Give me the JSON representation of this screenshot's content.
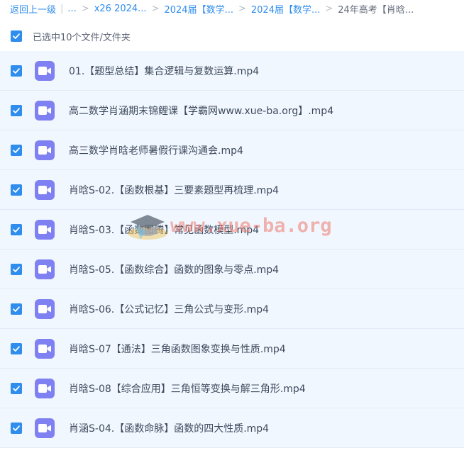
{
  "breadcrumb": {
    "back": "返回上一级",
    "ellipsis": "...",
    "items": [
      "x26 2024...",
      "2024届【数学...",
      "2024届【数学..."
    ],
    "current": "24年高考【肖晗..."
  },
  "selection": {
    "label": "已选中10个文件/文件夹"
  },
  "files": [
    {
      "name": "01.【题型总结】集合逻辑与复数运算.mp4"
    },
    {
      "name": "高二数学肖涵期末锦鲤课【学霸网www.xue-ba.org】.mp4"
    },
    {
      "name": "高三数学肖晗老师暑假行课沟通会.mp4"
    },
    {
      "name": "肖晗S-02.【函数根基】三要素题型再梳理.mp4"
    },
    {
      "name": "肖晗S-03.【函数图腾】常见函数模型.mp4"
    },
    {
      "name": "肖晗S-05.【函数综合】函数的图象与零点.mp4"
    },
    {
      "name": "肖晗S-06.【公式记忆】三角公式与变形.mp4"
    },
    {
      "name": "肖晗S-07【通法】三角函数图象变换与性质.mp4"
    },
    {
      "name": "肖晗S-08【综合应用】三角恒等变换与解三角形.mp4"
    },
    {
      "name": "肖涵S-04.【函数命脉】函数的四大性质.mp4"
    }
  ],
  "watermark": {
    "text": "www.xue-ba.org"
  },
  "colors": {
    "accent": "#2f8ded",
    "row_bg": "#f1f7fe",
    "video_icon": "#7f81f2"
  },
  "icons": {
    "checkbox": "check-icon",
    "file": "video-file-icon",
    "watermark_logo": "graduation-cap-icon"
  }
}
